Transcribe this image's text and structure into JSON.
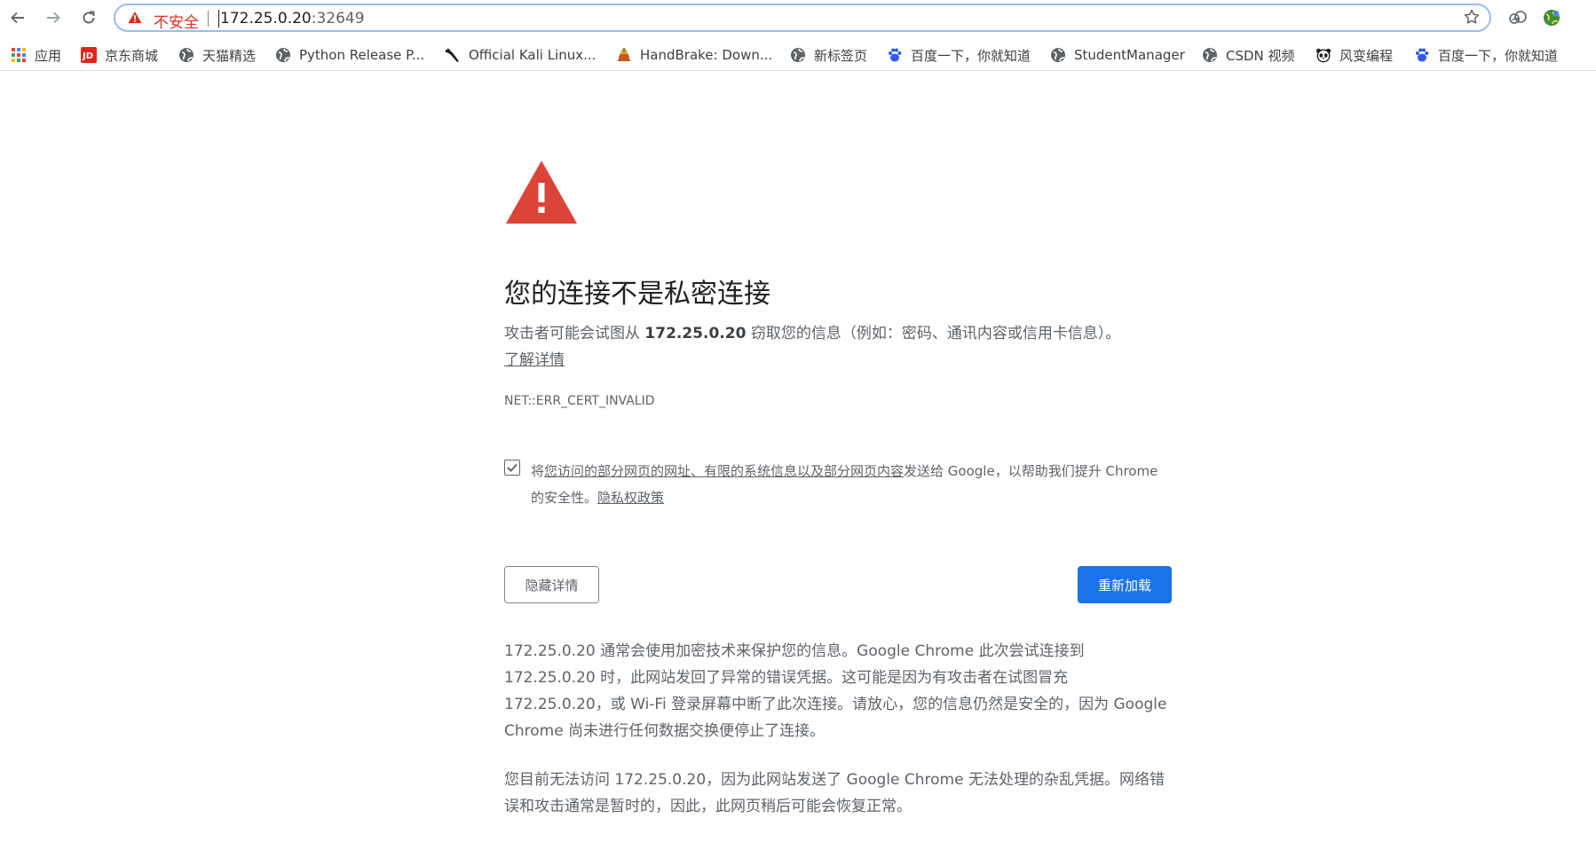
{
  "toolbar": {
    "insecure_label": "不安全",
    "url_host": "172.25.0.20",
    "url_port": ":32649"
  },
  "bookmarks": [
    {
      "label": "应用",
      "icon": "apps-grid-icon"
    },
    {
      "label": "京东商城",
      "icon": "jd-logo-icon"
    },
    {
      "label": "天猫精选",
      "icon": "globe-icon"
    },
    {
      "label": "Python Release P...",
      "icon": "globe-icon"
    },
    {
      "label": "Official Kali Linux...",
      "icon": "kali-dragon-icon"
    },
    {
      "label": "HandBrake: Down...",
      "icon": "handbrake-icon"
    },
    {
      "label": "新标签页",
      "icon": "globe-icon"
    },
    {
      "label": "百度一下，你就知道",
      "icon": "baidu-paw-icon"
    },
    {
      "label": "StudentManager",
      "icon": "globe-icon"
    },
    {
      "label": "CSDN 视频",
      "icon": "globe-icon"
    },
    {
      "label": "风变编程",
      "icon": "panda-icon"
    },
    {
      "label": "百度一下，你就知道",
      "icon": "baidu-paw-icon"
    }
  ],
  "interstitial": {
    "heading": "您的连接不是私密连接",
    "desc_prefix": "攻击者可能会试图从 ",
    "desc_host": "172.25.0.20",
    "desc_suffix": " 窃取您的信息（例如：密码、通讯内容或信用卡信息）。",
    "learn_more": "了解详情",
    "error_code": "NET::ERR_CERT_INVALID",
    "optin_prefix": "将",
    "optin_link": "您访问的部分网页的网址、有限的系统信息以及部分网页内容",
    "optin_suffix": "发送给 Google，以帮助我们提升 Chrome 的安全性。",
    "privacy_link": "隐私权政策",
    "hide_details_button": "隐藏详情",
    "reload_button": "重新加载",
    "details_paragraph_1": "172.25.0.20 通常会使用加密技术来保护您的信息。Google Chrome 此次尝试连接到 172.25.0.20 时，此网站发回了异常的错误凭据。这可能是因为有攻击者在试图冒充 172.25.0.20，或 Wi-Fi 登录屏幕中断了此次连接。请放心，您的信息仍然是安全的，因为 Google Chrome 尚未进行任何数据交换便停止了连接。",
    "details_paragraph_2": "您目前无法访问 172.25.0.20，因为此网站发送了 Google Chrome 无法处理的杂乱凭据。网络错误和攻击通常是暂时的，因此，此网页稍后可能会恢复正常。"
  },
  "colors": {
    "warning_red": "#db4437",
    "insecure_red": "#d93025",
    "button_blue": "#1a73e8"
  }
}
